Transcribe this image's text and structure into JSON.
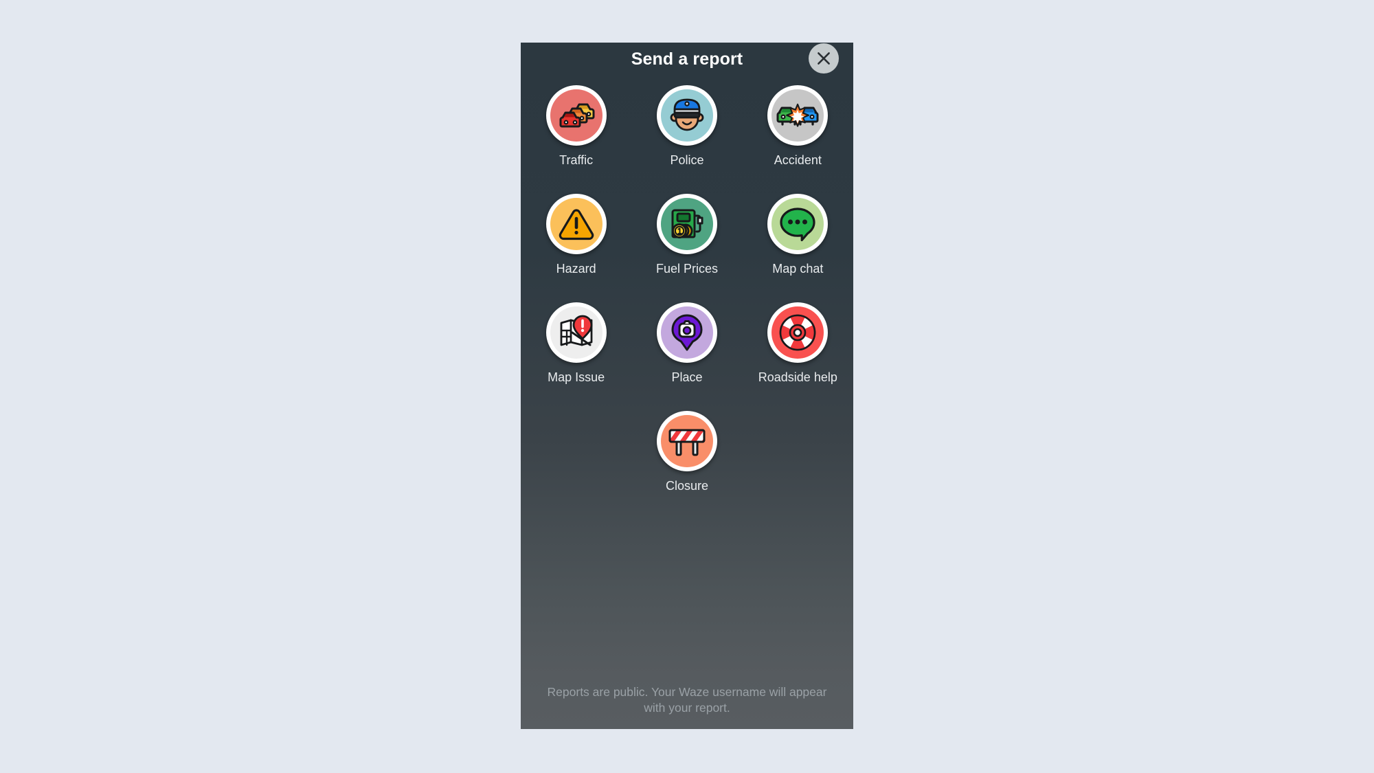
{
  "panel": {
    "title": "Send a report",
    "close_icon": "close-icon",
    "background_color": "#2c3840",
    "close_button_color": "#c5cbcd"
  },
  "reports": [
    {
      "id": "traffic",
      "label": "Traffic",
      "icon": "traffic-jam-icon",
      "disc_color": "#e8736e",
      "ring_color": "#ffffff"
    },
    {
      "id": "police",
      "label": "Police",
      "icon": "police-officer-icon",
      "disc_color": "#95ccd3",
      "ring_color": "#ffffff"
    },
    {
      "id": "accident",
      "label": "Accident",
      "icon": "car-crash-icon",
      "disc_color": "#c6c6c6",
      "ring_color": "#ffffff"
    },
    {
      "id": "hazard",
      "label": "Hazard",
      "icon": "warning-triangle-icon",
      "disc_color": "#fbc05a",
      "ring_color": "#ffffff"
    },
    {
      "id": "fuel-prices",
      "label": "Fuel Prices",
      "icon": "fuel-pump-coin-icon",
      "disc_color": "#4fa482",
      "ring_color": "#ffffff"
    },
    {
      "id": "map-chat",
      "label": "Map chat",
      "icon": "chat-bubble-icon",
      "disc_color": "#b9d997",
      "ring_color": "#ffffff"
    },
    {
      "id": "map-issue",
      "label": "Map Issue",
      "icon": "map-alert-icon",
      "disc_color": "#eeeeee",
      "ring_color": "#ffffff"
    },
    {
      "id": "place",
      "label": "Place",
      "icon": "place-pin-camera-icon",
      "disc_color": "#c3a8de",
      "ring_color": "#ffffff"
    },
    {
      "id": "roadside-help",
      "label": "Roadside help",
      "icon": "life-ring-icon",
      "disc_color": "#f9514f",
      "ring_color": "#ffffff"
    },
    {
      "id": "closure",
      "label": "Closure",
      "icon": "road-barrier-icon",
      "disc_color": "#f98e69",
      "ring_color": "#ffffff"
    }
  ],
  "footer": {
    "disclaimer": "Reports are public. Your Waze username will appear with your report."
  }
}
